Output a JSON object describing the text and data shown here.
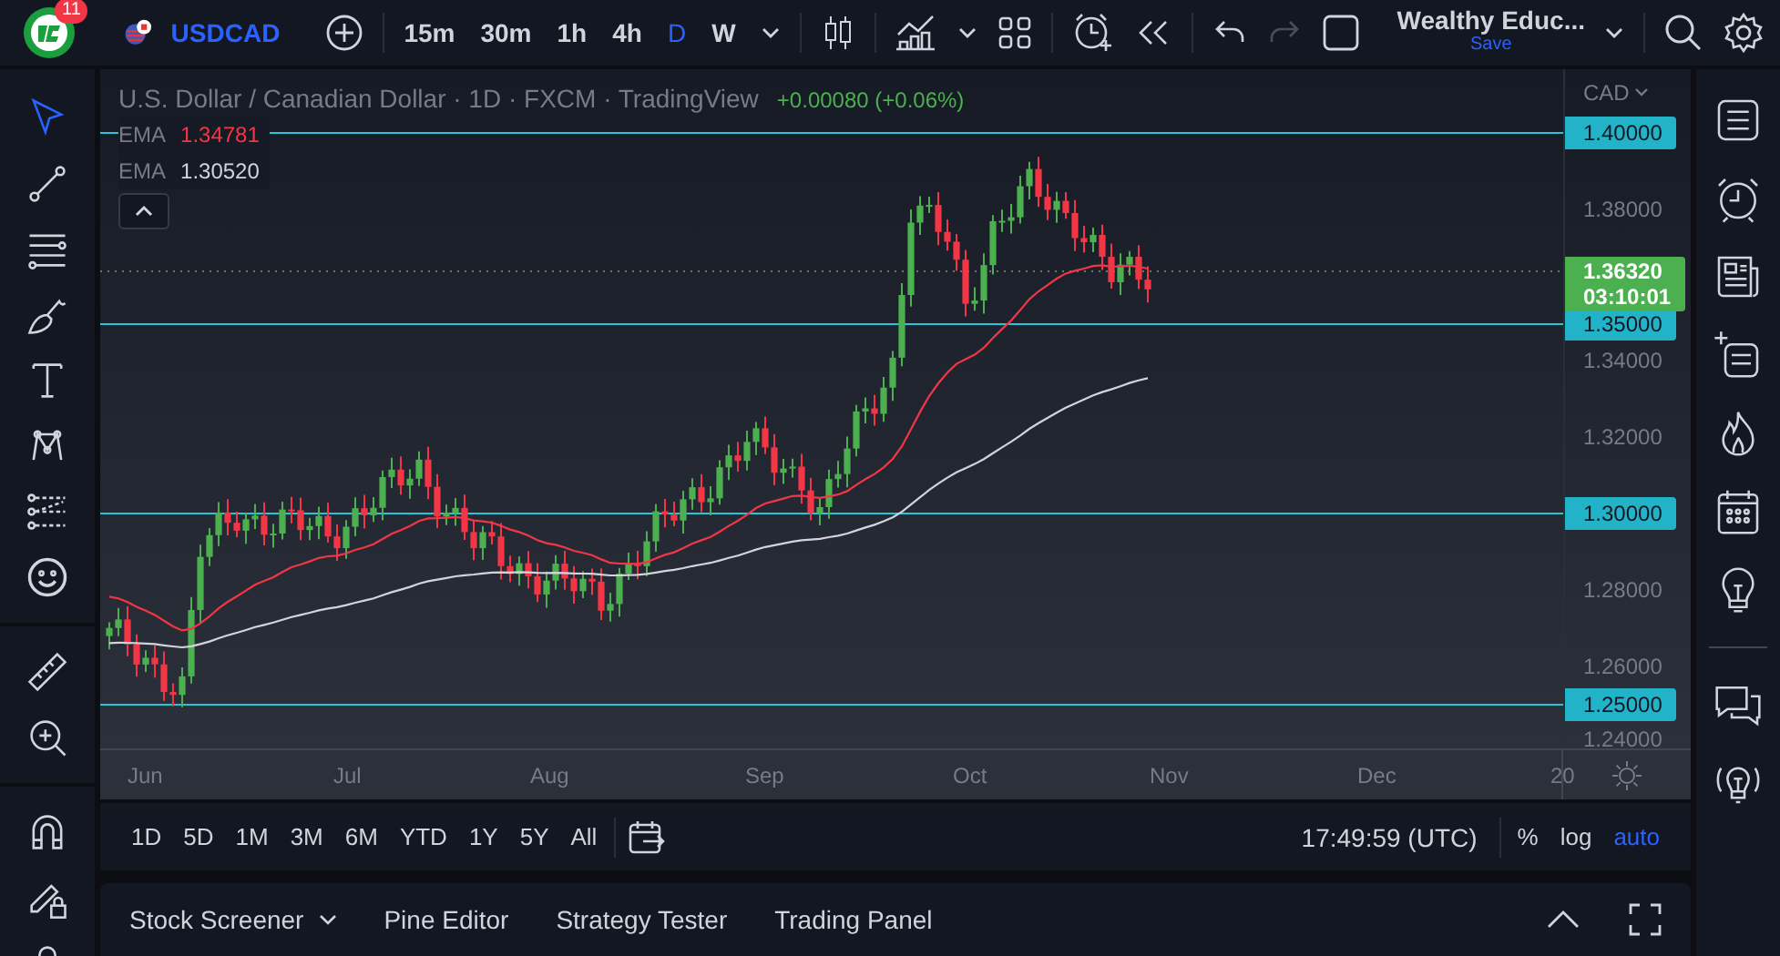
{
  "top_bar": {
    "notification_count": "11",
    "symbol": "USDCAD",
    "intervals": [
      {
        "label": "15m",
        "selected": false
      },
      {
        "label": "30m",
        "selected": false
      },
      {
        "label": "1h",
        "selected": false
      },
      {
        "label": "4h",
        "selected": false
      },
      {
        "label": "D",
        "selected": true
      },
      {
        "label": "W",
        "selected": false
      }
    ],
    "redo_disabled": true,
    "layout": {
      "name": "Wealthy Educ...",
      "status": "Save"
    }
  },
  "drawing_tools": [
    {
      "kind": "cursor",
      "selected": true
    },
    {
      "kind": "trend-line",
      "selected": false
    },
    {
      "kind": "fib",
      "selected": false
    },
    {
      "kind": "brush",
      "selected": false
    },
    {
      "kind": "text",
      "selected": false
    },
    {
      "kind": "pattern",
      "selected": false
    },
    {
      "kind": "forecast",
      "selected": false
    },
    {
      "kind": "emoji",
      "selected": false
    },
    {
      "kind": "ruler",
      "selected": false
    },
    {
      "kind": "zoom",
      "selected": false
    },
    {
      "kind": "magnet",
      "selected": false
    },
    {
      "kind": "lock-drawing",
      "selected": false
    },
    {
      "kind": "lock",
      "selected": false
    }
  ],
  "chart": {
    "title": "U.S. Dollar / Canadian Dollar · 1D · FXCM · TradingView",
    "change": "+0.00080 (+0.06%)",
    "indicators": [
      {
        "name": "EMA",
        "value": "1.34781",
        "color": "#f23645"
      },
      {
        "name": "EMA",
        "value": "1.30520",
        "color": "#d1d4dc"
      }
    ],
    "currency": "CAD",
    "price_labels": [
      {
        "text": "1.40000",
        "kind": "line"
      },
      {
        "text": "1.38000",
        "kind": "tick"
      },
      {
        "text": "1.35000",
        "kind": "line"
      },
      {
        "text": "1.34000",
        "kind": "tick"
      },
      {
        "text": "1.32000",
        "kind": "tick"
      },
      {
        "text": "1.30000",
        "kind": "line"
      },
      {
        "text": "1.28000",
        "kind": "tick"
      },
      {
        "text": "1.26000",
        "kind": "tick"
      },
      {
        "text": "1.25000",
        "kind": "line"
      },
      {
        "text": "1.24000",
        "kind": "tick"
      }
    ],
    "last_price": {
      "price": "1.36320",
      "countdown": "03:10:01"
    },
    "time_labels": [
      "Jun",
      "Jul",
      "Aug",
      "Sep",
      "Oct",
      "Nov",
      "Dec",
      "20"
    ]
  },
  "range_bar": {
    "ranges": [
      "1D",
      "5D",
      "1M",
      "3M",
      "6M",
      "YTD",
      "1Y",
      "5Y",
      "All"
    ],
    "clock": "17:49:59 (UTC)",
    "scale_options": [
      {
        "label": "%",
        "selected": false
      },
      {
        "label": "log",
        "selected": false
      },
      {
        "label": "auto",
        "selected": true
      }
    ]
  },
  "bottom_panel": {
    "tabs": [
      {
        "label": "Stock Screener",
        "dropdown": true
      },
      {
        "label": "Pine Editor",
        "dropdown": false
      },
      {
        "label": "Strategy Tester",
        "dropdown": false
      },
      {
        "label": "Trading Panel",
        "dropdown": false
      }
    ]
  },
  "right_sidebar": [
    {
      "kind": "watchlist"
    },
    {
      "kind": "alarm"
    },
    {
      "kind": "news"
    },
    {
      "kind": "add-list"
    },
    {
      "kind": "fire"
    },
    {
      "kind": "calendar"
    },
    {
      "kind": "idea"
    },
    {
      "kind": "divider"
    },
    {
      "kind": "chat"
    },
    {
      "kind": "broadcast"
    }
  ]
}
